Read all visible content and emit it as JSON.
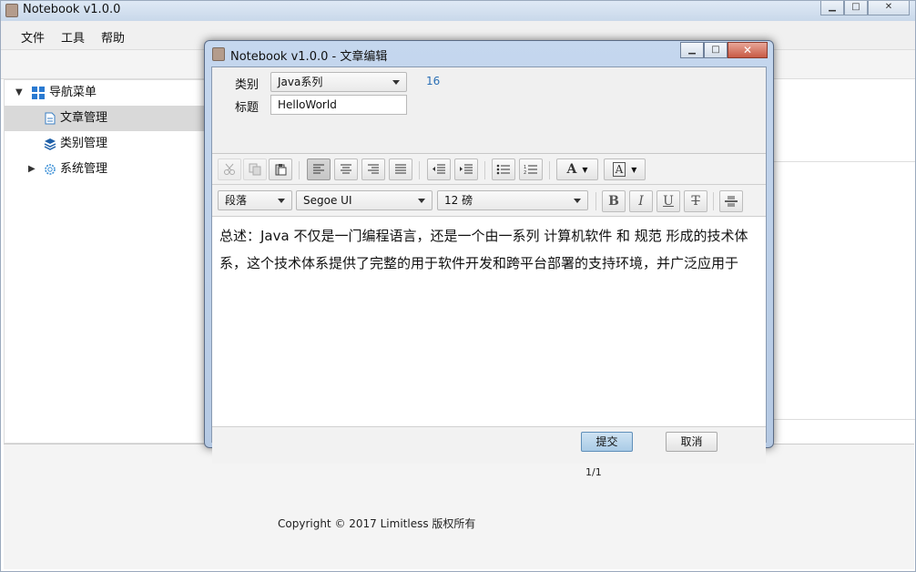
{
  "main_window": {
    "title": "Notebook v1.0.0",
    "controls": {
      "minimize": "▁",
      "maximize": "□",
      "close": "✕"
    }
  },
  "menu": {
    "items": [
      "文件",
      "工具",
      "帮助"
    ]
  },
  "tree": {
    "root": {
      "label": "导航菜单",
      "icon": "grid-icon",
      "expanded": true
    },
    "items": [
      {
        "label": "文章管理",
        "icon": "document-icon",
        "selected": true
      },
      {
        "label": "类别管理",
        "icon": "layers-icon",
        "selected": false
      },
      {
        "label": "系统管理",
        "icon": "gear-icon",
        "selected": false,
        "collapsed": true
      }
    ]
  },
  "pager": {
    "current": "1",
    "info": "1/1"
  },
  "footer": {
    "copyright": "Copyright © 2017 Limitless 版权所有"
  },
  "dialog": {
    "title": "Notebook v1.0.0 - 文章编辑",
    "category_label": "类别",
    "category_value": "Java系列",
    "count": "16",
    "title_label": "标题",
    "title_value": "HelloWorld",
    "toolbar": {
      "paragraph": "段落",
      "font": "Segoe UI",
      "size": "12 磅",
      "bold": "B",
      "italic": "I",
      "underline": "U",
      "strike": "T"
    },
    "content": "总述：Java 不仅是一门编程语言，还是一个由一系列 计算机软件 和 规范 形成的技术体系，这个技术体系提供了完整的用于软件开发和跨平台部署的支持环境，并广泛应用于",
    "buttons": {
      "submit": "提交",
      "cancel": "取消"
    }
  },
  "colors": {
    "accent": "#0a6aa1",
    "selected_row": "#d9d9d9",
    "dialog_frame": "#b5c9e3"
  }
}
